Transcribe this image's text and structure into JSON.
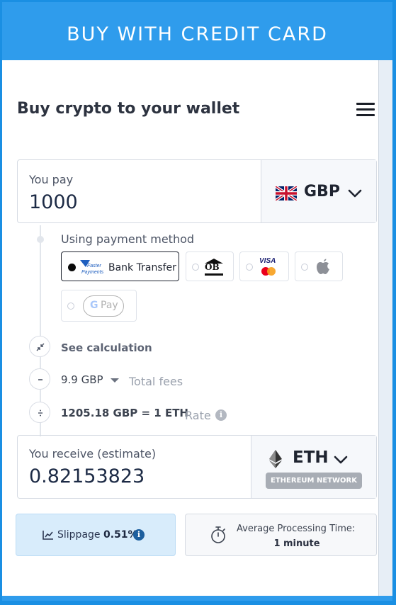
{
  "header": {
    "title": "BUY WITH CREDIT CARD"
  },
  "page": {
    "title": "Buy crypto to your wallet"
  },
  "pay": {
    "label": "You pay",
    "amount": "1000",
    "currency": "GBP",
    "flag_icon": "uk-flag-icon"
  },
  "payment_method": {
    "label": "Using payment method",
    "options": [
      {
        "label": "Bank Transfer",
        "logo_text": "Faster Payments",
        "selected": true
      },
      {
        "label": "OB",
        "selected": false
      },
      {
        "label": "VISA",
        "selected": false
      },
      {
        "label": "Apple Pay",
        "selected": false
      },
      {
        "label": "Pay",
        "logo_prefix": "G",
        "selected": false,
        "disabled": true
      }
    ]
  },
  "calculation": {
    "see_label": "See calculation",
    "fee_value": "9.9 GBP",
    "fee_label": "Total fees",
    "rate_value": "1205.18 GBP = 1 ETH",
    "rate_label": "Rate",
    "info_glyph": "i"
  },
  "receive": {
    "label": "You receive (estimate)",
    "amount": "0.82153823",
    "currency": "ETH",
    "network": "ETHEREUM NETWORK"
  },
  "slippage": {
    "label": "Slippage",
    "value": "0.51%"
  },
  "processing": {
    "label": "Average Processing Time:",
    "value": "1 minute"
  },
  "colors": {
    "header_blue": "#2f9cec",
    "slippage_bg": "#d8ecfb",
    "info_blue": "#1d5f9e",
    "text_dark": "#1f2430"
  }
}
